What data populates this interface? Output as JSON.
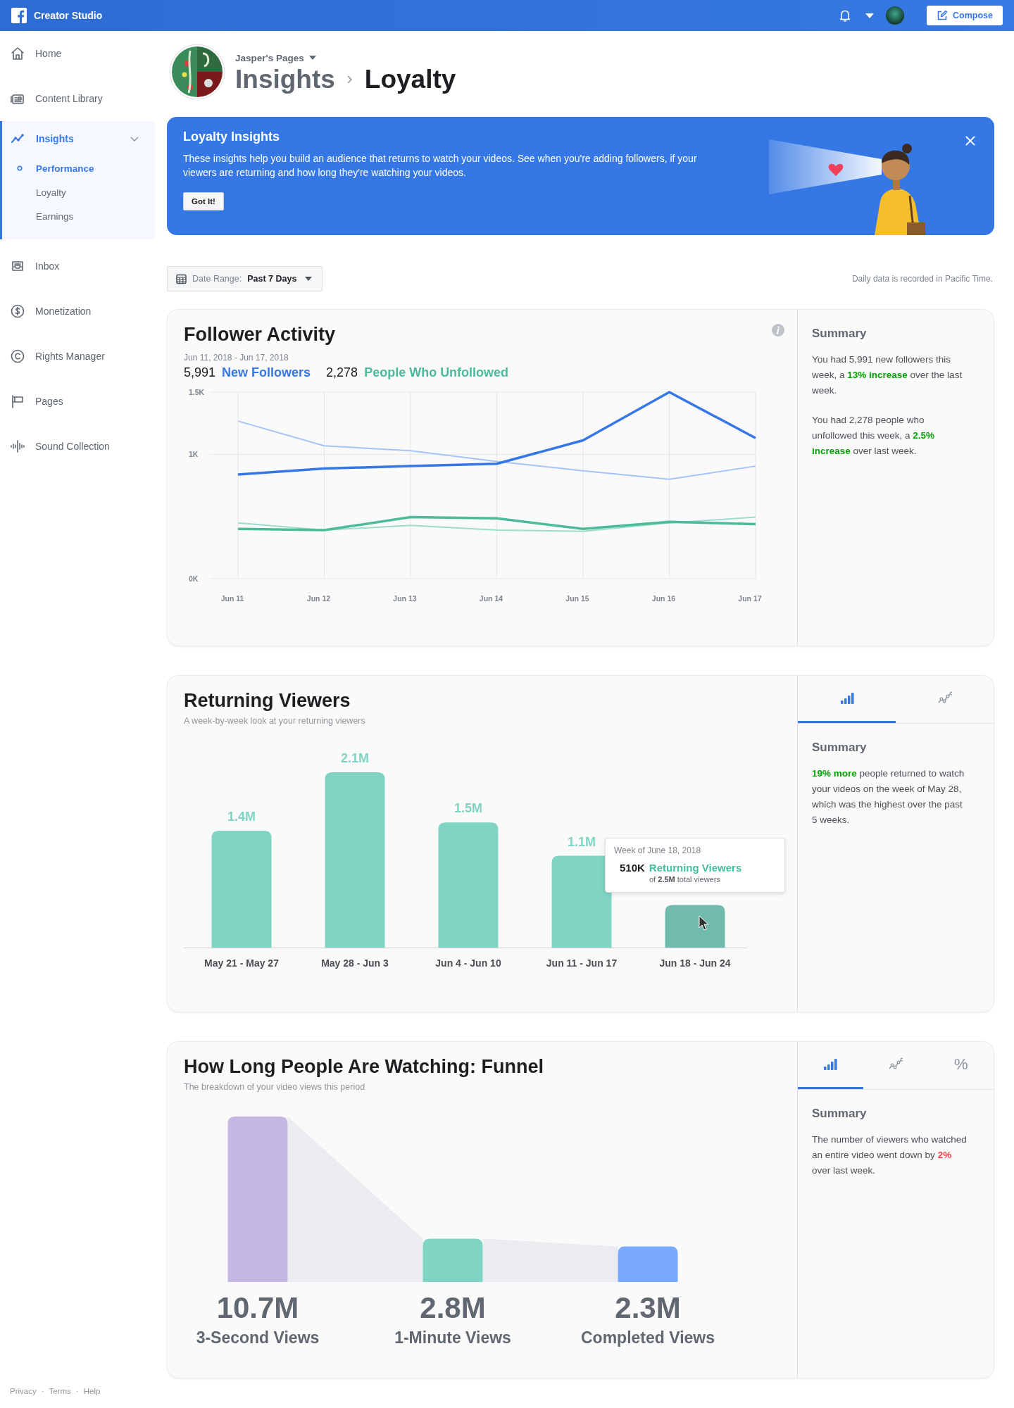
{
  "topbar": {
    "title": "Creator Studio",
    "compose": "Compose"
  },
  "sidebar": {
    "items": [
      {
        "label": "Home",
        "kind": "home",
        "selected": false
      },
      {
        "label": "Content Library",
        "kind": "library",
        "selected": false
      },
      {
        "label": "Insights",
        "kind": "insights",
        "selected": true,
        "expanded": true,
        "children": [
          {
            "label": "Performance",
            "selected": true
          },
          {
            "label": "Loyalty",
            "selected": false
          },
          {
            "label": "Earnings",
            "selected": false
          }
        ]
      },
      {
        "label": "Inbox",
        "kind": "inbox",
        "selected": false
      },
      {
        "label": "Monetization",
        "kind": "dollar",
        "selected": false
      },
      {
        "label": "Rights Manager",
        "kind": "copyright",
        "selected": false
      },
      {
        "label": "Pages",
        "kind": "flag",
        "selected": false
      },
      {
        "label": "Sound Collection",
        "kind": "sound",
        "selected": false
      }
    ],
    "footer": {
      "links": [
        "Privacy",
        "Terms",
        "Help"
      ],
      "separator": "·"
    }
  },
  "header": {
    "page_name": "Jasper's Pages",
    "breadcrumb": [
      "Insights",
      "Loyalty"
    ]
  },
  "banner": {
    "title": "Loyalty Insights",
    "text": "These insights help you build an audience that returns to watch your videos. See when you're adding followers, if your viewers are returning and how long they're watching your videos.",
    "button": "Got It!"
  },
  "date_range": {
    "label": "Date Range:",
    "value": "Past 7 Days"
  },
  "timezone_note": "Daily data is recorded in Pacific Time.",
  "follower_activity": {
    "title": "Follower Activity",
    "date_range": "Jun 11, 2018 - Jun 17, 2018",
    "stats": [
      {
        "value": "5,991"
      },
      {
        "value": "2,278"
      }
    ],
    "chart_data": {
      "type": "line",
      "x": [
        "Jun 11",
        "Jun 12",
        "Jun 13",
        "Jun 14",
        "Jun 15",
        "Jun 16",
        "Jun 17"
      ],
      "ylim": [
        0,
        1500
      ],
      "yticks": [
        {
          "value": 0,
          "label": "0K"
        },
        {
          "value": 1000,
          "label": "1K"
        },
        {
          "value": 1500,
          "label": "1.5K"
        }
      ],
      "series": [
        {
          "color": "#a6c4fa",
          "values": [
            1267,
            1068,
            1029,
            943,
            867,
            800,
            905
          ]
        },
        {
          "color": "#9edccb",
          "values": [
            448,
            390,
            429,
            390,
            381,
            448,
            495
          ]
        },
        {
          "name": "New Followers",
          "color": "#3578e5",
          "values": [
            838,
            886,
            905,
            924,
            1112,
            1500,
            1131
          ]
        },
        {
          "name": "People Who Unfollowed",
          "color": "#4bbb9c",
          "values": [
            400,
            390,
            495,
            486,
            400,
            457,
            438
          ]
        }
      ]
    },
    "summary": {
      "title": "Summary",
      "paragraphs": [
        {
          "text": "You had 5,991 new followers this week, a **13% increase** over the last week.",
          "kind": "increase"
        },
        {
          "text": "You had 2,278 people who unfollowed this week, a **2.5% increase** over last week.",
          "kind": "increase"
        }
      ]
    }
  },
  "returning_viewers": {
    "title": "Returning Viewers",
    "subtitle": "A week-by-week look at your returning viewers",
    "chart_data": {
      "type": "bar",
      "categories": [
        "May 21 - May 27",
        "May 28 - Jun 3",
        "Jun 4 - Jun 10",
        "Jun 11 - Jun 17",
        "Jun 18 - Jun 24"
      ],
      "values": [
        1400000,
        2100000,
        1500000,
        1100000,
        510000
      ],
      "value_labels": [
        "1.4M",
        "2.1M",
        "1.5M",
        "1.1M",
        null
      ]
    },
    "tooltip": {
      "title": "Week of June 18, 2018",
      "value": "510K",
      "label": "Returning Viewers",
      "detail": "of **2.5M** total viewers"
    },
    "tabs": [
      {
        "kind": "bar",
        "selected": true
      },
      {
        "kind": "line",
        "selected": false
      }
    ],
    "summary": {
      "title": "Summary",
      "paragraphs": [
        {
          "text": "**19% more** people returned to watch your videos on the week of May 28, which was the highest over the past 5 weeks.",
          "kind": "increase"
        }
      ]
    }
  },
  "funnel": {
    "title": "How Long People Are Watching: Funnel",
    "subtitle": "The breakdown of your video views this period",
    "chart_data": {
      "type": "bar",
      "categories": [
        "3-Second Views",
        "1-Minute Views",
        "Completed Views"
      ],
      "values": [
        10700000,
        2800000,
        2300000
      ],
      "value_labels": [
        "10.7M",
        "2.8M",
        "2.3M"
      ]
    },
    "tabs": [
      {
        "kind": "bar",
        "selected": true
      },
      {
        "kind": "line",
        "selected": false
      },
      {
        "kind": "percent",
        "label": "%",
        "selected": false
      }
    ],
    "summary": {
      "title": "Summary",
      "paragraphs": [
        {
          "text": "The number of viewers who watched an entire video went down by **2%** over last week.",
          "kind": "decrease"
        }
      ]
    }
  }
}
